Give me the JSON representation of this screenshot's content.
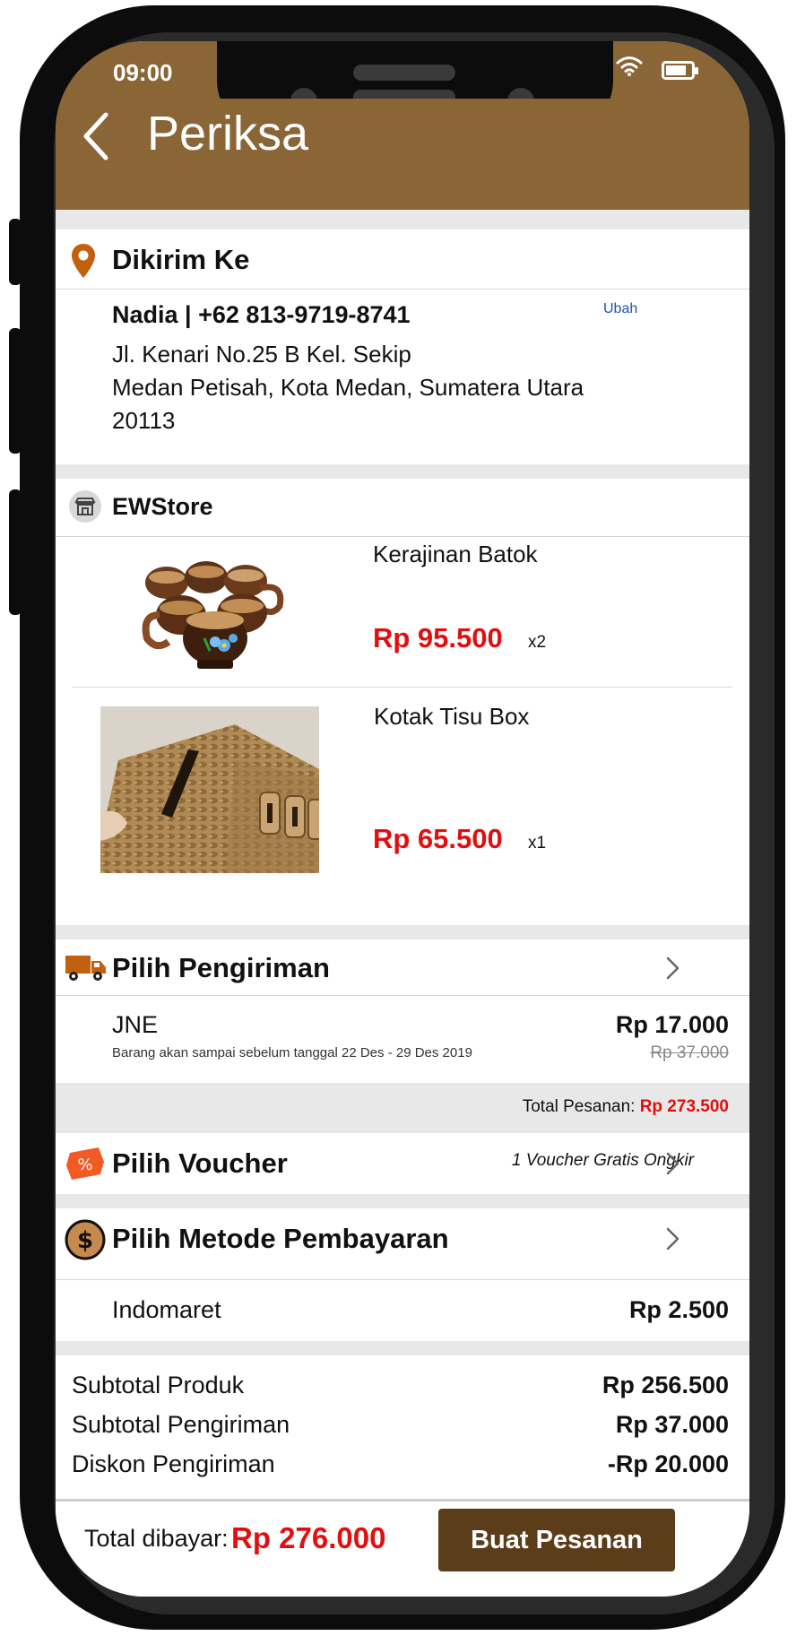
{
  "status": {
    "time": "09:00"
  },
  "header": {
    "title": "Periksa"
  },
  "shipping_address": {
    "heading": "Dikirim Ke",
    "name_phone": "Nadia  |  +62 813-9719-8741",
    "change_label": "Ubah",
    "line1": "Jl. Kenari No.25 B Kel. Sekip",
    "line2": "Medan Petisah, Kota Medan, Sumatera Utara",
    "line3": "20113"
  },
  "store": {
    "name": "EWStore",
    "products": [
      {
        "name": "Kerajinan Batok",
        "price": "Rp 95.500",
        "qty": "x2"
      },
      {
        "name": "Kotak Tisu Box",
        "price": "Rp 65.500",
        "qty": "x1"
      }
    ]
  },
  "delivery": {
    "heading": "Pilih Pengiriman",
    "courier": "JNE",
    "eta": "Barang akan sampai sebelum tanggal 22 Des - 29 Des 2019",
    "price": "Rp 17.000",
    "original_price": "Rp 37.000"
  },
  "order_total": {
    "label": "Total Pesanan:",
    "value": "Rp 273.500"
  },
  "voucher": {
    "heading": "Pilih Voucher",
    "info": "1 Voucher Gratis Ongkir"
  },
  "payment": {
    "heading": "Pilih Metode Pembayaran",
    "method": "Indomaret",
    "fee": "Rp 2.500"
  },
  "summary": {
    "rows": [
      {
        "label": "Subtotal Produk",
        "value": "Rp 256.500"
      },
      {
        "label": "Subtotal Pengiriman",
        "value": "Rp 37.000"
      },
      {
        "label": "Diskon Pengiriman",
        "value": "-Rp 20.000"
      }
    ]
  },
  "footer": {
    "total_label": "Total dibayar:",
    "total_value": "Rp 276.000",
    "button_label": "Buat Pesanan"
  },
  "colors": {
    "brand": "#8a6536",
    "button": "#5b3d1a",
    "price_red": "#e10f0f",
    "link_blue": "#1a56b0"
  }
}
